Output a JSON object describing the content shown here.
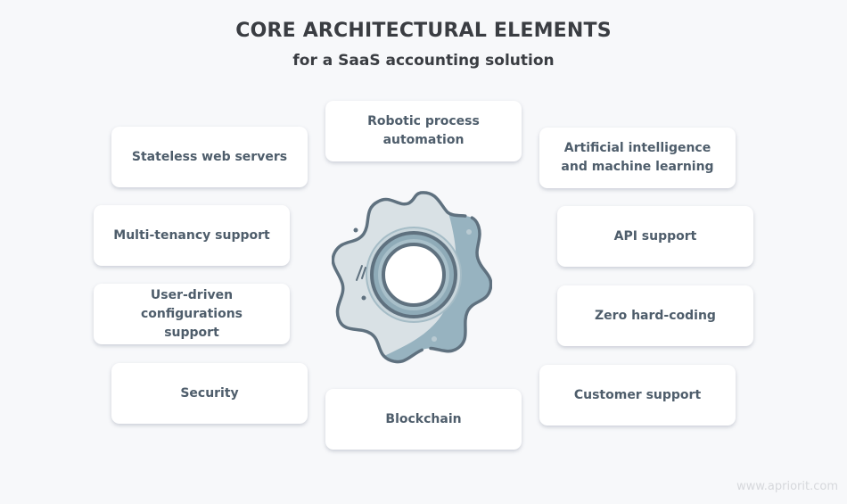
{
  "header": {
    "title": "CORE ARCHITECTURAL ELEMENTS",
    "subtitle": "for a SaaS accounting solution"
  },
  "elements": [
    {
      "label": "Stateless web servers"
    },
    {
      "label": "Robotic process automation"
    },
    {
      "label": "Artificial intelligence and machine learning"
    },
    {
      "label": "Multi-tenancy support"
    },
    {
      "label": "API support"
    },
    {
      "label": "User-driven configurations support"
    },
    {
      "label": "Zero hard-coding"
    },
    {
      "label": "Security"
    },
    {
      "label": "Blockchain"
    },
    {
      "label": "Customer support"
    }
  ],
  "center_icon": "gear-icon",
  "colors": {
    "background": "#f7f8fa",
    "card": "#ffffff",
    "text": "#4e5d6b",
    "title": "#3a3d42",
    "gear_outline": "#5f717f",
    "gear_light": "#d9e1e5",
    "gear_shade": "#97b3c0"
  },
  "watermark": "www.apriorit.com"
}
